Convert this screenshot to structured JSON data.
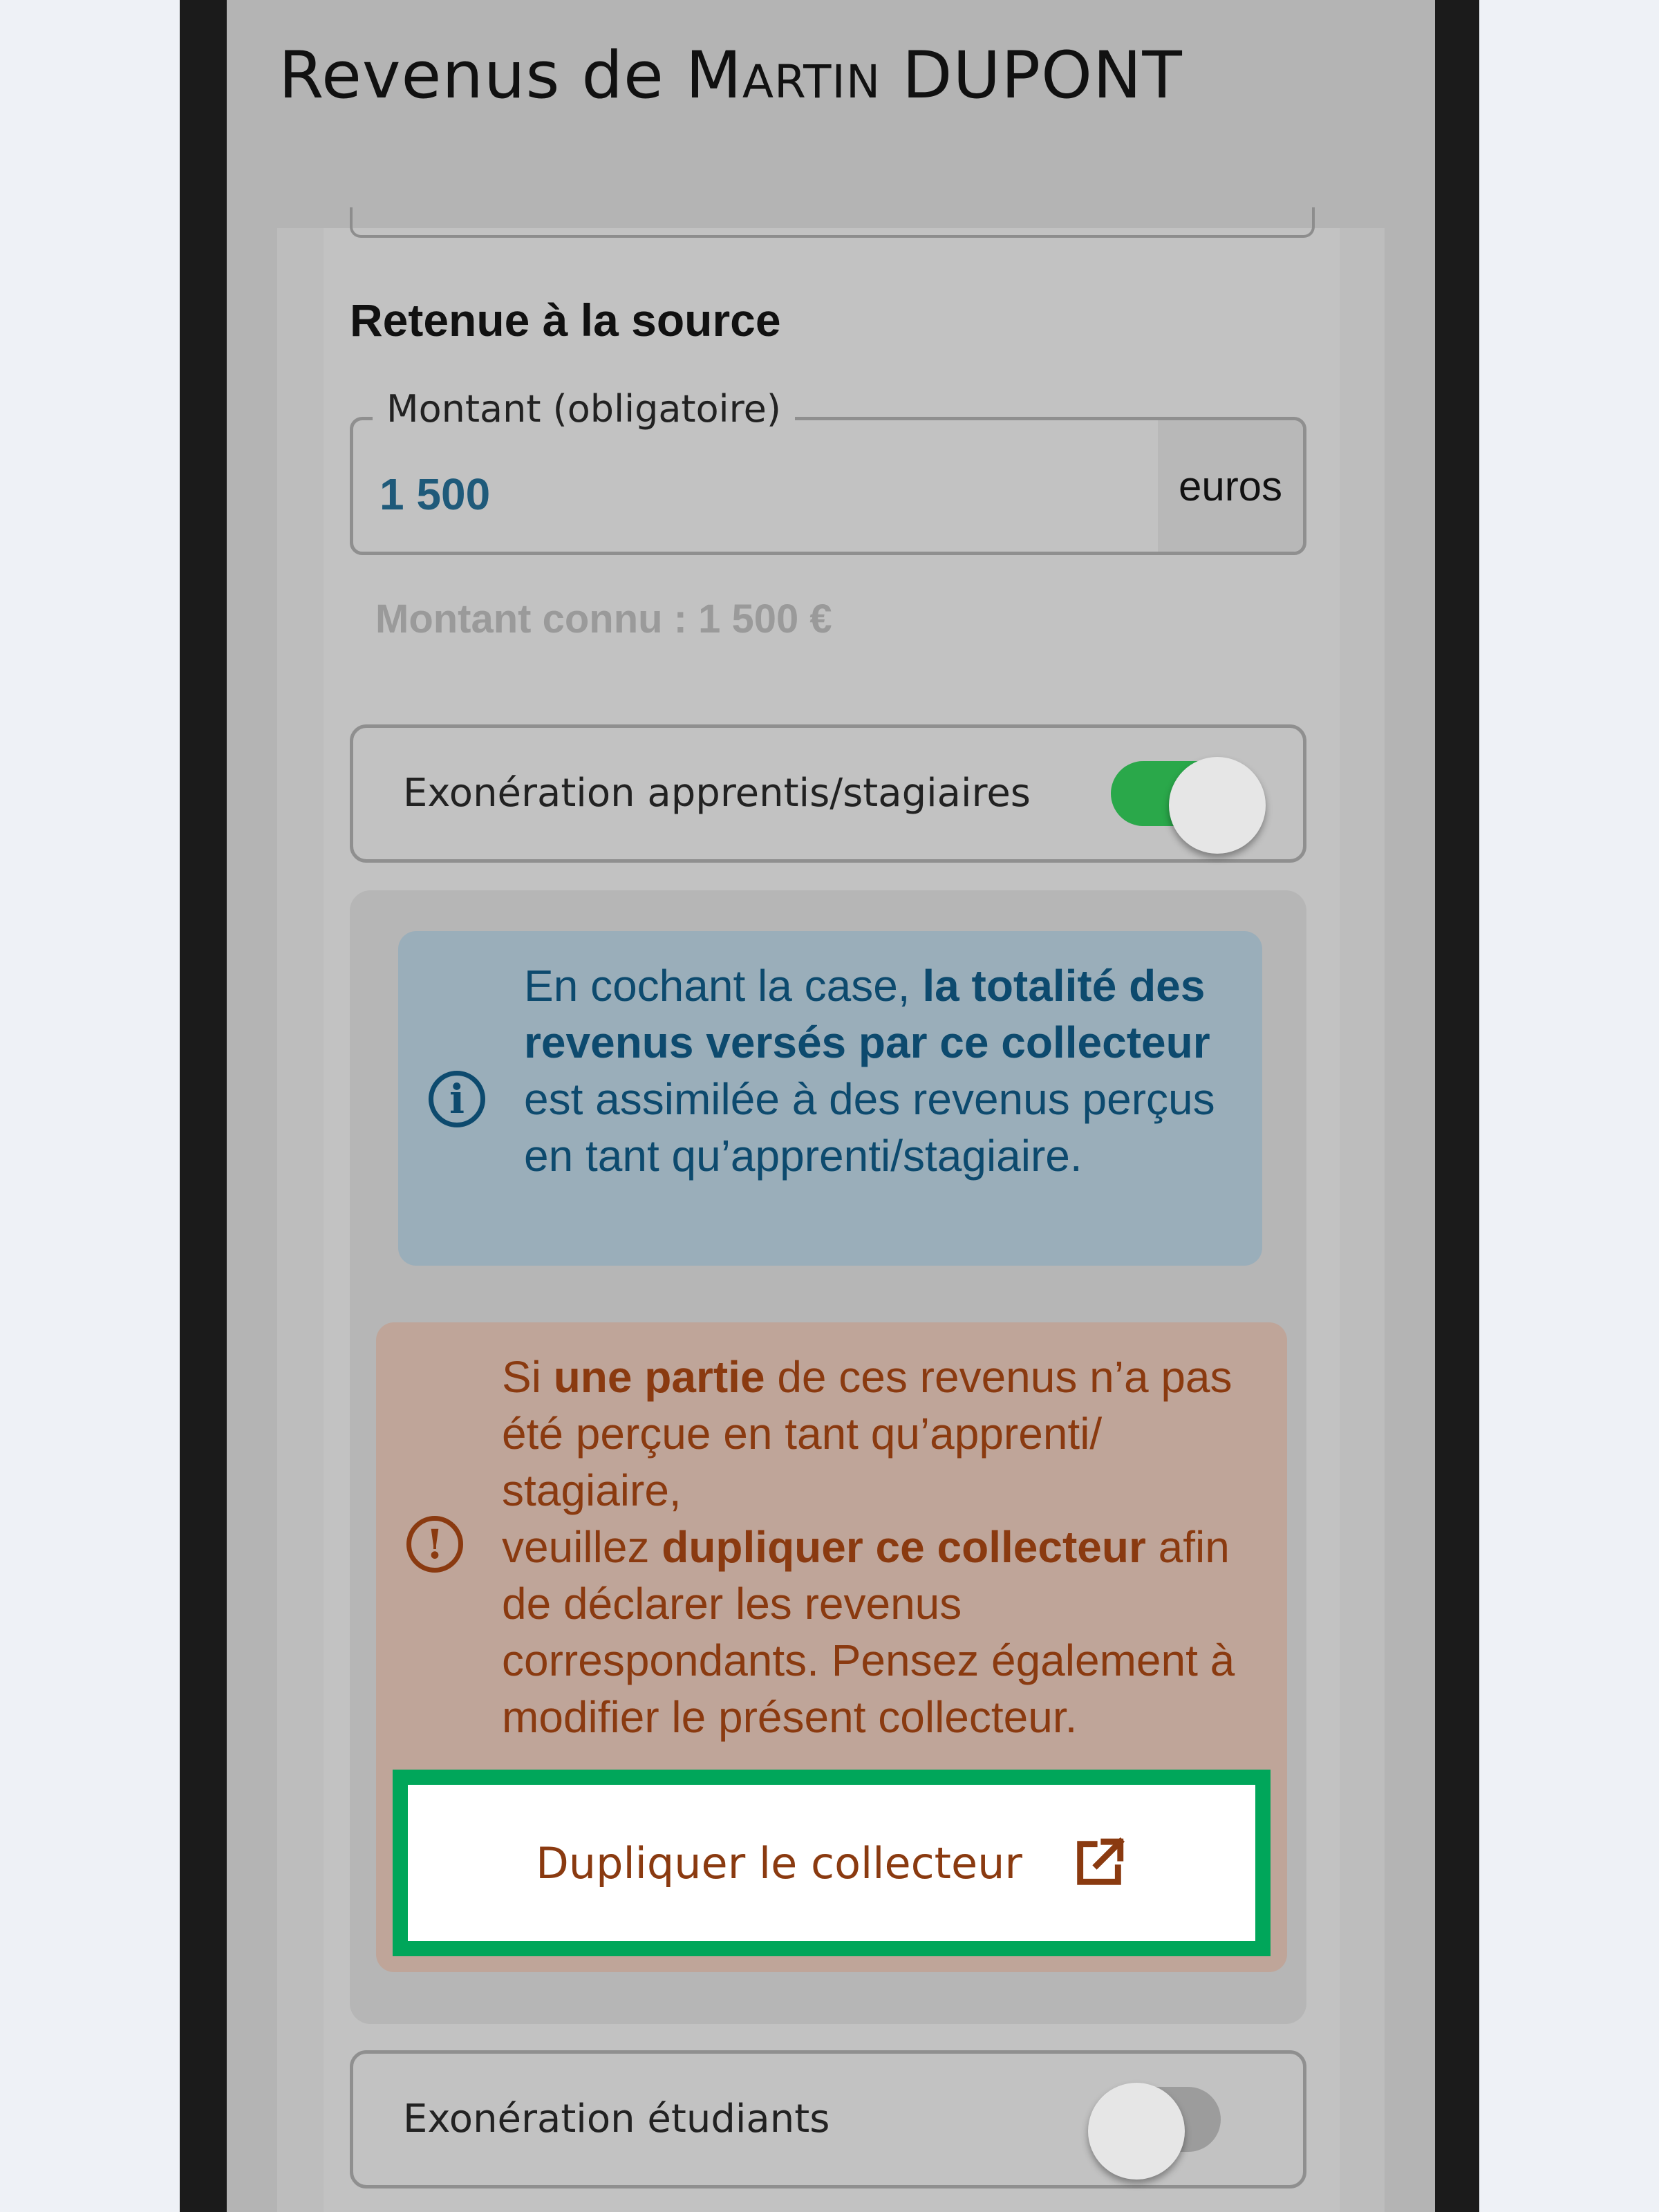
{
  "header": {
    "title_prefix": "Revenus de ",
    "user_first": "Martin",
    "user_last": "DUPONT"
  },
  "section": {
    "title": "Retenue à la source",
    "amount": {
      "label": "Montant (obligatoire)",
      "value": "1 500",
      "unit": "euros",
      "known_amount": "Montant connu : 1 500 €"
    }
  },
  "toggles": {
    "apprentis": {
      "label": "Exonération apprentis/stagiaires",
      "on": true
    },
    "etudiants": {
      "label": "Exonération étudiants",
      "on": false
    }
  },
  "info": {
    "icon": "info-icon",
    "part1": "En cochant la case, ",
    "bold1": "la totalité des revenus versés par ce collecteur",
    "part2": " est assimilée à des revenus perçus en tant qu’apprenti/stagiaire."
  },
  "alert": {
    "icon": "exclamation-icon",
    "part1": "Si ",
    "bold1": "une partie",
    "part2": " de ces revenus n’a pas été perçue en tant qu’apprenti/ stagiaire,",
    "part3": "veuillez ",
    "bold2": "dupliquer ce collecteur",
    "part4": " afin de déclarer les revenus correspondants. Pensez également à modifier le présent collecteur."
  },
  "duplicate_button": {
    "label": "Dupliquer le collecteur",
    "icon": "external-link-icon"
  },
  "colors": {
    "info_text": "#0d4a6e",
    "alert_text": "#8a3a10",
    "toggle_on": "#2aa84a",
    "highlight": "#00a65a"
  }
}
